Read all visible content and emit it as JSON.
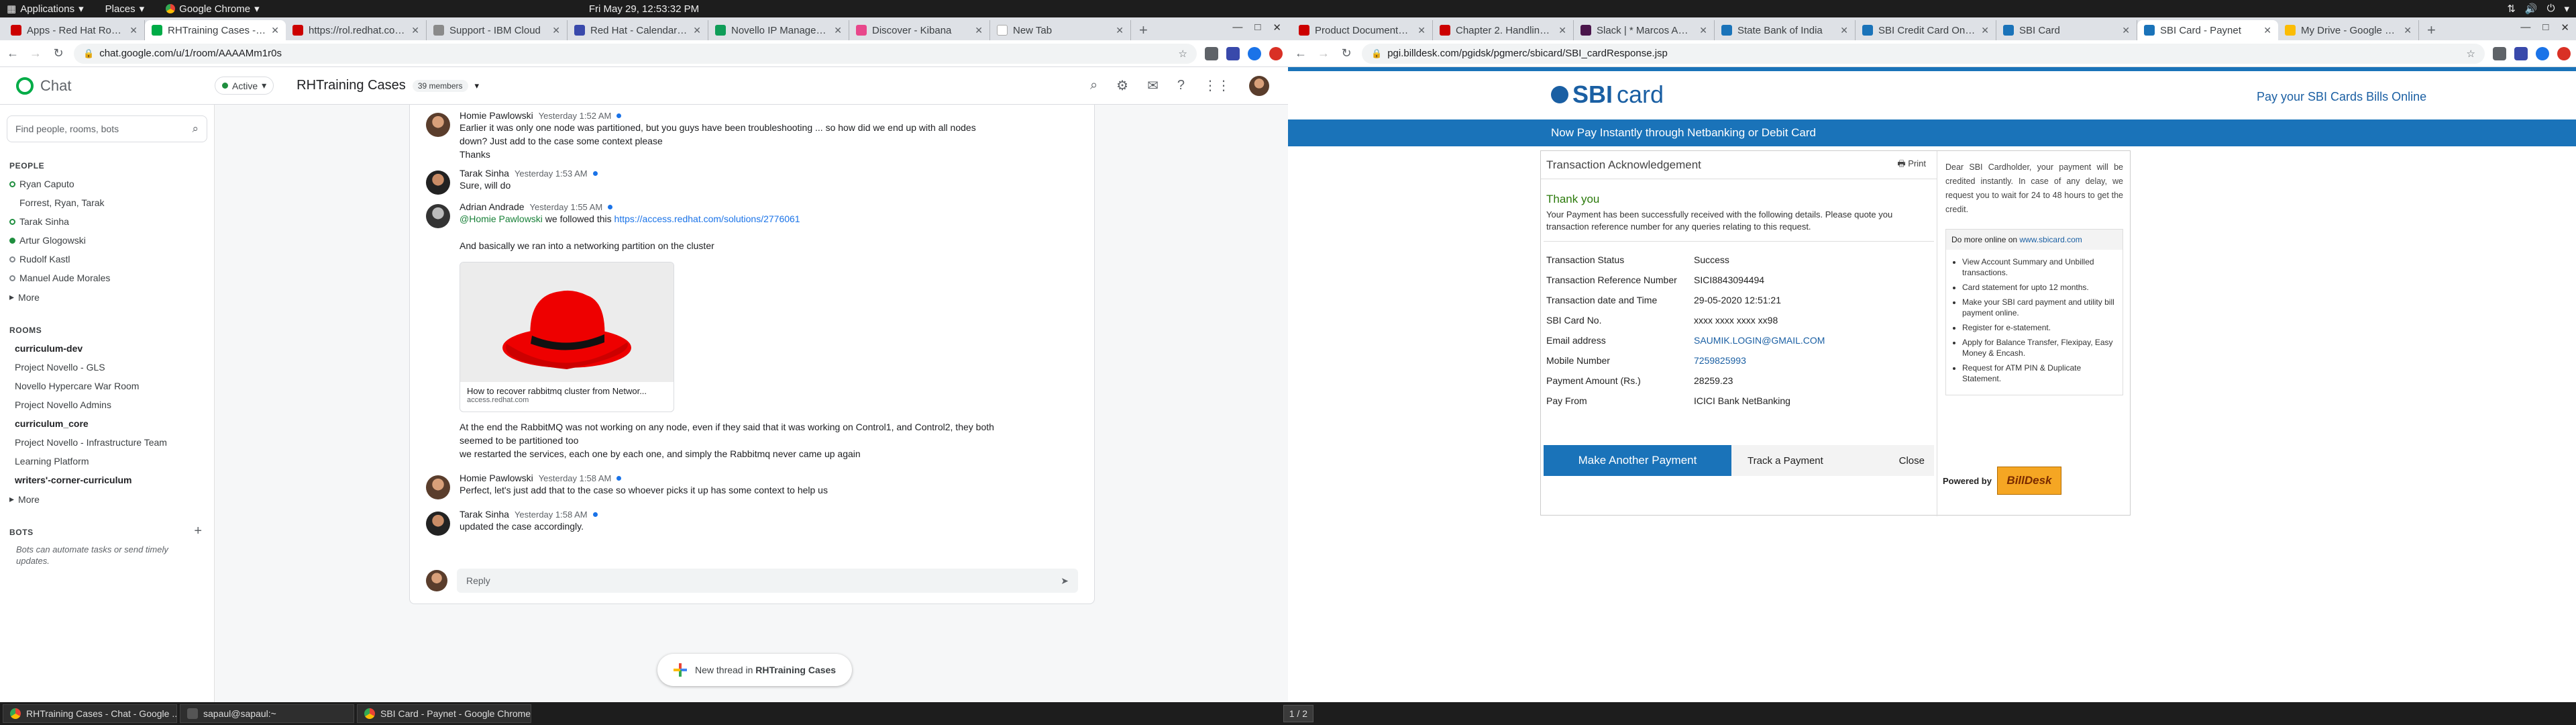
{
  "system": {
    "menus": [
      "Applications",
      "Places",
      "Google Chrome"
    ],
    "clock": "Fri May 29, 12:53:32 PM"
  },
  "left_window": {
    "tabs": [
      {
        "label": "Apps - Red Hat Rover",
        "color": "#cc0000",
        "active": false
      },
      {
        "label": "RHTraining Cases - Chat",
        "color": "#00ac47",
        "active": true
      },
      {
        "label": "https://rol.redhat.com/r",
        "color": "#cc0000",
        "active": false
      },
      {
        "label": "Support - IBM Cloud",
        "color": "#8a8a8a",
        "active": false
      },
      {
        "label": "Red Hat - Calendar - Wee",
        "color": "#3949ab",
        "active": false
      },
      {
        "label": "Novello IP Manageme",
        "color": "#0f9d58",
        "active": false
      },
      {
        "label": "Discover - Kibana",
        "color": "#e8478b",
        "active": false
      },
      {
        "label": "New Tab",
        "color": "#ffffff",
        "active": false
      }
    ],
    "url": "chat.google.com/u/1/room/AAAAMm1r0s",
    "chat": {
      "app_name": "Chat",
      "status": "Active",
      "room_title": "RHTraining Cases",
      "member_count": "39 members",
      "search_placeholder": "Find people, rooms, bots",
      "people_heading": "PEOPLE",
      "people": [
        {
          "name": "Ryan Caputo",
          "state": "away"
        },
        {
          "name": "Forrest, Ryan, Tarak",
          "state": "none"
        },
        {
          "name": "Tarak Sinha",
          "state": "away"
        },
        {
          "name": "Artur Glogowski",
          "state": "online"
        },
        {
          "name": "Rudolf Kastl",
          "state": "offline"
        },
        {
          "name": "Manuel Aude Morales",
          "state": "offline"
        }
      ],
      "more_label": "More",
      "rooms_heading": "ROOMS",
      "rooms": [
        {
          "name": "curriculum-dev",
          "bold": true
        },
        {
          "name": "Project Novello - GLS",
          "bold": false
        },
        {
          "name": "Novello Hypercare War Room",
          "bold": false
        },
        {
          "name": "Project Novello Admins",
          "bold": false
        },
        {
          "name": "curriculum_core",
          "bold": true
        },
        {
          "name": "Project Novello - Infrastructure Team",
          "bold": false
        },
        {
          "name": "Learning Platform",
          "bold": false
        },
        {
          "name": "writers'-corner-curriculum",
          "bold": true
        }
      ],
      "bots_heading": "BOTS",
      "bots_note": "Bots can automate tasks or send timely updates.",
      "messages": [
        {
          "author": "Homie Pawlowski",
          "time": "Yesterday 1:52 AM",
          "lines": [
            "Earlier it was only one node was partitioned, but you guys have been troubleshooting ... so how did we end up with all nodes",
            "down? Just add to the case some context please",
            "Thanks"
          ]
        },
        {
          "author": "Tarak Sinha",
          "time": "Yesterday 1:53 AM",
          "lines": [
            "Sure, will do"
          ]
        },
        {
          "author": "Adrian Andrade",
          "time": "Yesterday 1:55 AM",
          "mention": "@Homie Pawlowski",
          "mid": " we followed this ",
          "link": "https://access.redhat.com/solutions/2776061",
          "line2": "And basically we ran into a networking partition on the cluster",
          "card_title": "How to recover rabbitmq cluster from Networ...",
          "card_domain": "access.redhat.com",
          "after": [
            "At the end the RabbitMQ was not working on any node, even if they said that it was working on Control1, and Control2, they both",
            "seemed to be partitioned too",
            "we restarted the services, each one by each one, and simply the Rabbitmq never came up again"
          ]
        },
        {
          "author": "Homie Pawlowski",
          "time": "Yesterday 1:58 AM",
          "lines": [
            "Perfect, let's just add that to the case so whoever picks it up has some context to help us"
          ]
        },
        {
          "author": "Tarak Sinha",
          "time": "Yesterday 1:58 AM",
          "lines": [
            "updated the case accordingly."
          ]
        }
      ],
      "reply_placeholder": "Reply",
      "new_thread_prefix": "New thread in ",
      "new_thread_room": "RHTraining Cases"
    }
  },
  "right_window": {
    "tabs": [
      {
        "label": "Product Documentation",
        "color": "#cc0000",
        "active": false
      },
      {
        "label": "Chapter 2. Handling a d",
        "color": "#cc0000",
        "active": false
      },
      {
        "label": "Slack | * Marcos Amor",
        "color": "#4a154b",
        "active": false
      },
      {
        "label": "State Bank of India",
        "color": "#1a73b9",
        "active": false
      },
      {
        "label": "SBI Credit Card Online",
        "color": "#1a73b9",
        "active": false
      },
      {
        "label": "SBI Card",
        "color": "#1a73b9",
        "active": false
      },
      {
        "label": "SBI Card - Paynet",
        "color": "#1a73b9",
        "active": true
      },
      {
        "label": "My Drive - Google Driv",
        "color": "#fbbc04",
        "active": false
      }
    ],
    "url": "pgi.billdesk.com/pgidsk/pgmerc/sbicard/SBI_cardResponse.jsp",
    "sbi": {
      "logo_bold": "SBI",
      "logo_rest": "card",
      "header_text": "Pay your SBI Cards Bills Online",
      "banner": "Now Pay Instantly through Netbanking or Debit Card",
      "panel_title": "Transaction Acknowledgement",
      "print_label": "Print",
      "thank_you": "Thank you",
      "thank_msg": "Your Payment has been successfully received with the following details. Please quote you transaction reference number for any queries relating to this request.",
      "rows": [
        {
          "k": "Transaction Status",
          "v": "Success",
          "blue": false
        },
        {
          "k": "Transaction Reference Number",
          "v": "SICI8843094494",
          "blue": false
        },
        {
          "k": "Transaction date and Time",
          "v": "29-05-2020 12:51:21",
          "blue": false
        },
        {
          "k": "SBI Card No.",
          "v": "xxxx xxxx xxxx xx98",
          "blue": false
        },
        {
          "k": "Email address",
          "v": "SAUMIK.LOGIN@GMAIL.COM",
          "blue": true
        },
        {
          "k": "Mobile Number",
          "v": "7259825993",
          "blue": true
        },
        {
          "k": "Payment Amount (Rs.)",
          "v": "28259.23",
          "blue": false
        },
        {
          "k": "Pay From",
          "v": "ICICI Bank NetBanking",
          "blue": false
        }
      ],
      "make_another": "Make Another Payment",
      "track": "Track a Payment",
      "close": "Close",
      "dear": "Dear SBI Cardholder, your payment will be credited instantly. In case of any delay, we request you to wait for 24 to 48 hours to get the credit.",
      "do_more_prefix": "Do more online on ",
      "do_more_link": "www.sbicard.com",
      "do_more_items": [
        "View Account Summary and Unbilled transactions.",
        "Card statement for upto 12 months.",
        "Make your SBI card payment and utility bill payment online.",
        "Register for e-statement.",
        "Apply for Balance Transfer, Flexipay, Easy Money & Encash.",
        "Request for ATM PIN & Duplicate Statement."
      ],
      "powered_by": "Powered by",
      "billdesk": "BillDesk"
    }
  },
  "taskbar": {
    "items": [
      "RHTraining Cases - Chat - Google ...",
      "sapaul@sapaul:~",
      "SBI Card - Paynet - Google Chrome"
    ],
    "pager": "1 / 2"
  }
}
